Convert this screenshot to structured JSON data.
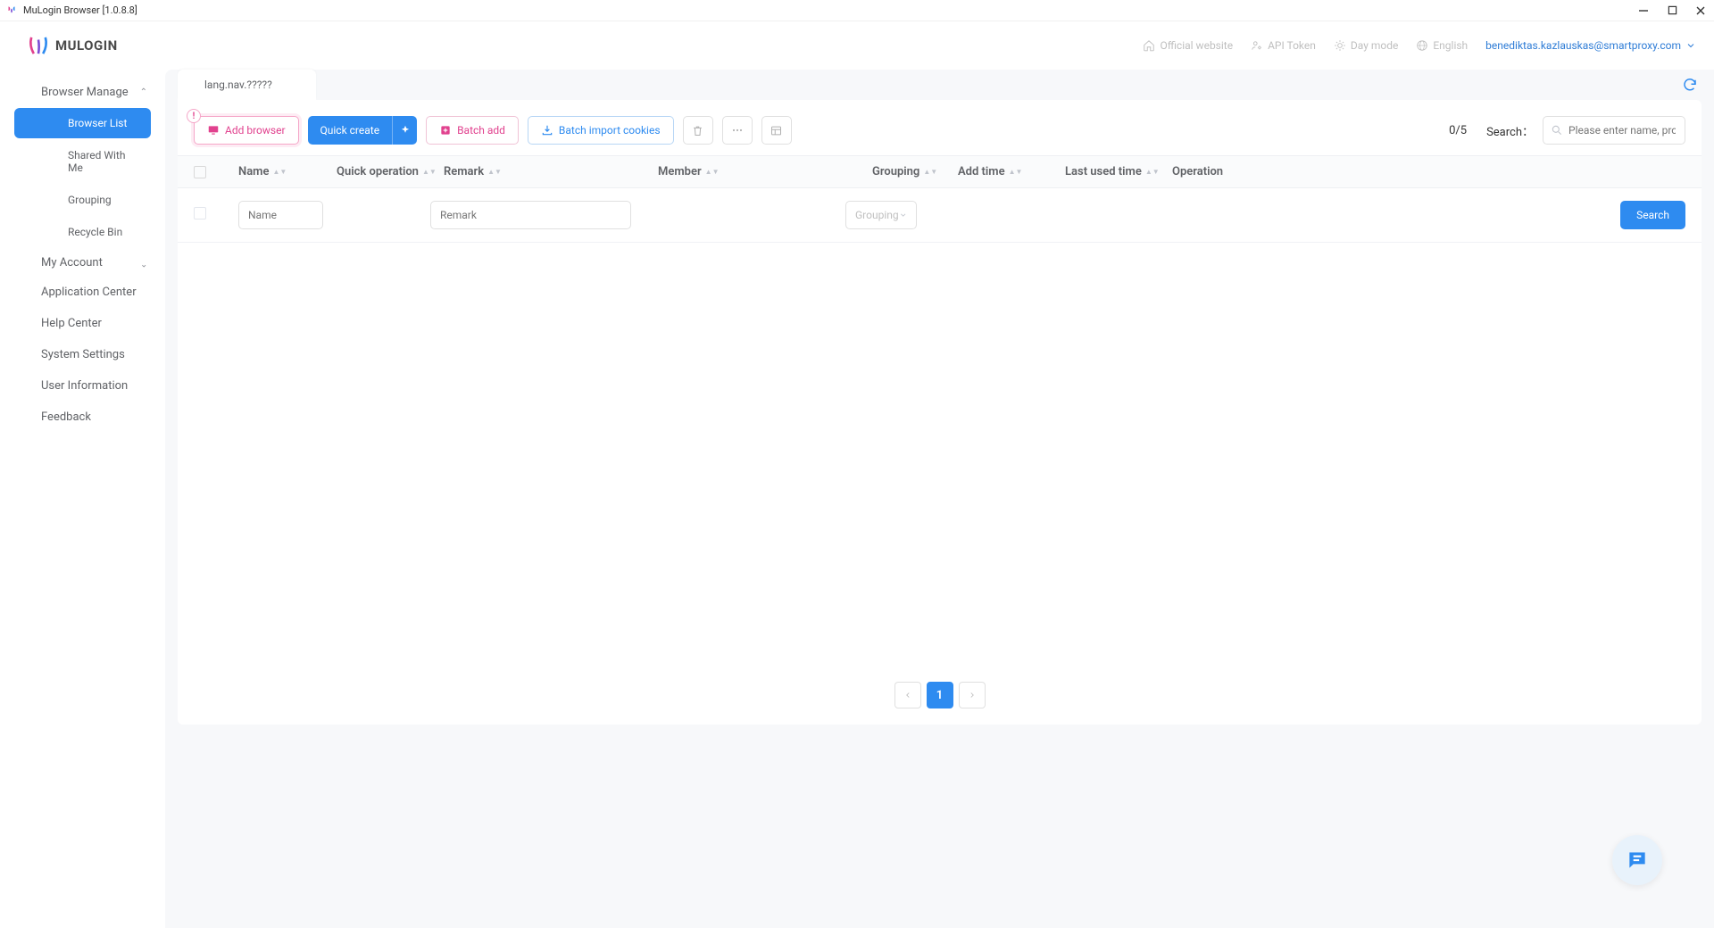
{
  "window": {
    "title": "MuLogin Browser  [1.0.8.8]"
  },
  "header": {
    "brand": "MULOGIN",
    "links": {
      "official": "Official website",
      "api": "API Token",
      "daymode": "Day mode",
      "lang": "English"
    },
    "user_email": "benediktas.kazlauskas@smartproxy.com"
  },
  "sidebar": {
    "browser_manage": "Browser Manage",
    "items": {
      "browser_list": "Browser List",
      "shared": "Shared With Me",
      "grouping": "Grouping",
      "recycle": "Recycle Bin"
    },
    "my_account": "My Account",
    "app_center": "Application Center",
    "help_center": "Help Center",
    "system_settings": "System Settings",
    "user_info": "User Information",
    "feedback": "Feedback"
  },
  "tab": {
    "label": "lang.nav.?????"
  },
  "toolbar": {
    "add_browser": "Add browser",
    "quick_create": "Quick create",
    "batch_add": "Batch add",
    "batch_import": "Batch import cookies",
    "count": "0/5",
    "search_label": "Search：",
    "search_placeholder": "Please enter name, profileID"
  },
  "table": {
    "cols": {
      "name": "Name",
      "qop": "Quick operation",
      "remark": "Remark",
      "member": "Member",
      "grouping": "Grouping",
      "addtime": "Add time",
      "lastused": "Last used time",
      "operation": "Operation"
    },
    "filters": {
      "name_ph": "Name",
      "remark_ph": "Remark",
      "grouping_ph": "Grouping",
      "search_btn": "Search"
    }
  },
  "pagination": {
    "current": "1"
  }
}
